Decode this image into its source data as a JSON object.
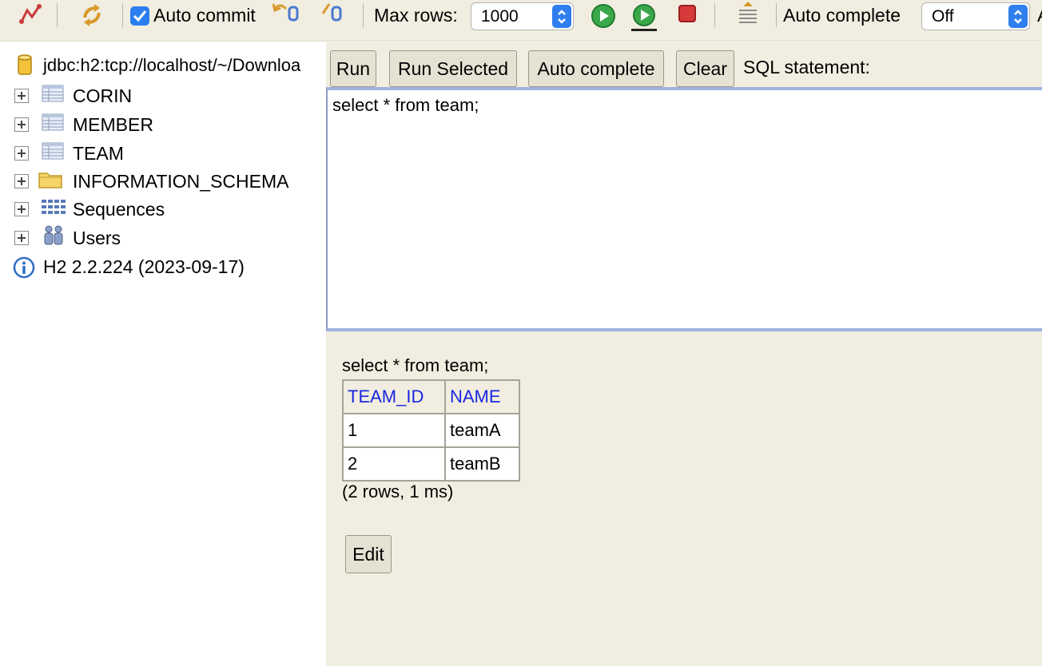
{
  "toolbar": {
    "auto_commit_label": "Auto commit",
    "auto_commit_checked": true,
    "max_rows_label": "Max rows:",
    "max_rows_value": "1000",
    "auto_complete_label": "Auto complete",
    "auto_complete_value": "Off",
    "trailing_char": "A",
    "icons": [
      "disconnect-icon",
      "refresh-icon",
      "rollback-icon",
      "commit-icon",
      "run-icon",
      "run-selected-icon",
      "stop-icon",
      "history-icon"
    ]
  },
  "tree": {
    "connection": "jdbc:h2:tcp://localhost/~/Downloa",
    "items": [
      {
        "label": "CORIN",
        "icon": "table-icon"
      },
      {
        "label": "MEMBER",
        "icon": "table-icon"
      },
      {
        "label": "TEAM",
        "icon": "table-icon"
      },
      {
        "label": "INFORMATION_SCHEMA",
        "icon": "folder-icon"
      },
      {
        "label": "Sequences",
        "icon": "sequences-icon"
      },
      {
        "label": "Users",
        "icon": "users-icon"
      }
    ],
    "version": "H2 2.2.224 (2023-09-17)"
  },
  "sql": {
    "buttons": {
      "run": "Run",
      "run_selected": "Run Selected",
      "auto_complete": "Auto complete",
      "clear": "Clear"
    },
    "statement_label": "SQL statement:",
    "text": "select * from team;"
  },
  "results": {
    "statement": "select * from team;",
    "columns": [
      "TEAM_ID",
      "NAME"
    ],
    "rows": [
      [
        "1",
        "teamA"
      ],
      [
        "2",
        "teamB"
      ]
    ],
    "info": "(2 rows, 1 ms)",
    "edit_label": "Edit"
  },
  "colors": {
    "panel_bg": "#f1ede0",
    "header_text": "#1a26e0",
    "accent_blue": "#2f7fef",
    "editor_border": "#9fb2de"
  }
}
